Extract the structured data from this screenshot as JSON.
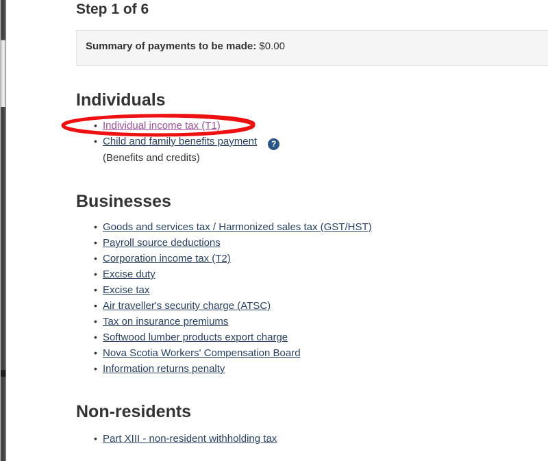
{
  "page": {
    "step_heading": "Step 1 of 6",
    "background_color": "#ffffff"
  },
  "summary": {
    "label": "Summary of payments to be made:",
    "amount": "$0.00",
    "background_color": "#f5f5f5",
    "border_color": "#e3e3e3"
  },
  "sections": {
    "individuals": {
      "heading": "Individuals",
      "items": [
        {
          "label": "Individual income tax (T1)",
          "state": "visited",
          "has_help_icon": false,
          "sub_label": ""
        },
        {
          "label": "Child and family benefits payment",
          "state": "default",
          "has_help_icon": true,
          "sub_label": "(Benefits and credits)"
        }
      ]
    },
    "businesses": {
      "heading": "Businesses",
      "items": [
        {
          "label": "Goods and services tax / Harmonized sales tax (GST/HST)"
        },
        {
          "label": "Payroll source deductions"
        },
        {
          "label": "Corporation income tax (T2)"
        },
        {
          "label": "Excise duty"
        },
        {
          "label": "Excise tax"
        },
        {
          "label": "Air traveller's security charge (ATSC)"
        },
        {
          "label": "Tax on insurance premiums"
        },
        {
          "label": "Softwood lumber products export charge"
        },
        {
          "label": "Nova Scotia Workers' Compensation Board"
        },
        {
          "label": "Information returns penalty"
        }
      ]
    },
    "nonresidents": {
      "heading": "Non-residents",
      "items": [
        {
          "label": "Part XIII - non-resident withholding tax"
        }
      ]
    }
  },
  "icons": {
    "help_icon_glyph": "?",
    "help_icon_color": "#2a5584"
  },
  "annotation": {
    "type": "ellipse-highlight",
    "color": "#ee1111",
    "targets": "Individual income tax (T1)"
  },
  "colors": {
    "link": "#284162",
    "link_visited": "#7834bc",
    "text": "#333333"
  },
  "scrollbar": {
    "orientation": "vertical",
    "position": "left-edge"
  }
}
